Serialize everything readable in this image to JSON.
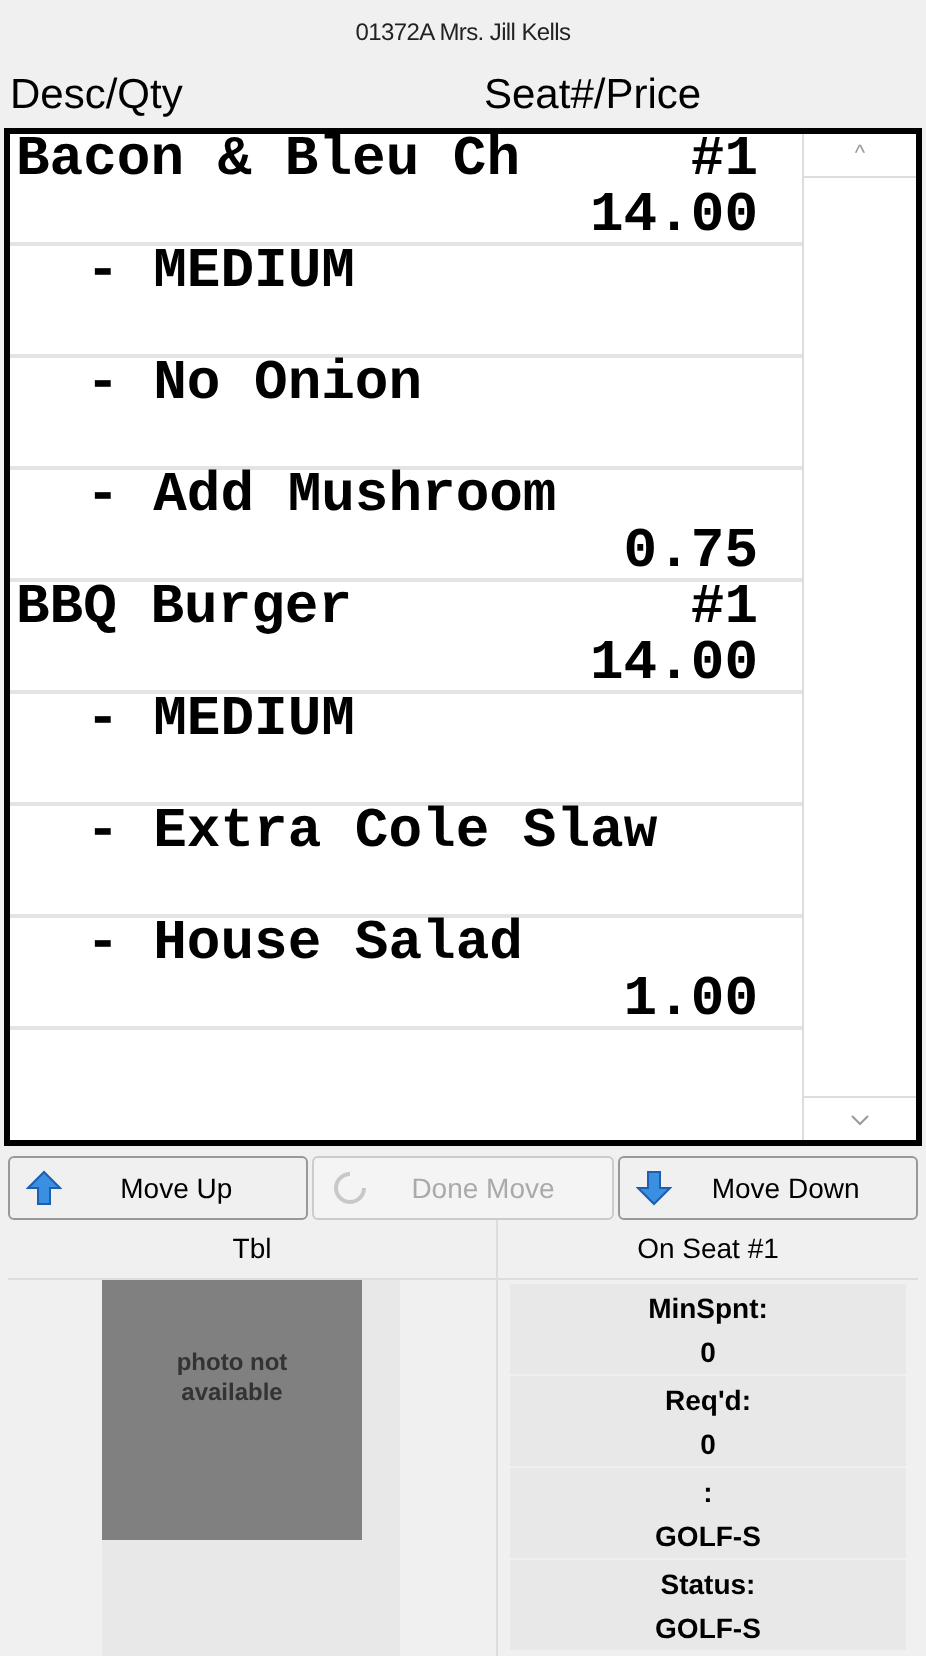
{
  "title": "01372A Mrs. Jill Kells",
  "columns": [
    "Desc/Qty",
    "Seat#/Price"
  ],
  "items": [
    {
      "kind": "item",
      "desc": "Bacon & Bleu Ch",
      "seat": "#1",
      "price": "14.00"
    },
    {
      "kind": "modifier",
      "desc": "- MEDIUM"
    },
    {
      "kind": "modifier",
      "desc": "- No Onion"
    },
    {
      "kind": "modifier",
      "desc": "- Add Mushroom",
      "price": "0.75"
    },
    {
      "kind": "item",
      "desc": "BBQ Burger",
      "seat": "#1",
      "price": "14.00"
    },
    {
      "kind": "modifier",
      "desc": "- MEDIUM"
    },
    {
      "kind": "modifier",
      "desc": "- Extra Cole Slaw"
    },
    {
      "kind": "modifier",
      "desc": "- House Salad",
      "price": "1.00"
    }
  ],
  "scroll_up": "^",
  "buttons": [
    {
      "kind": "up",
      "label": "Move Up",
      "disabled": false
    },
    {
      "kind": "done",
      "label": "Done Move",
      "disabled": true
    },
    {
      "kind": "down",
      "label": "Move Down",
      "disabled": false
    }
  ],
  "table_header": [
    "Tbl",
    "On Seat #1"
  ],
  "photo_text": "photo not available",
  "info": [
    {
      "label": "MinSpnt:",
      "value": "0"
    },
    {
      "label": "Req'd:",
      "value": "0"
    },
    {
      "label": ":",
      "value": "GOLF-S"
    },
    {
      "label": "Status:",
      "value": "GOLF-S"
    }
  ]
}
